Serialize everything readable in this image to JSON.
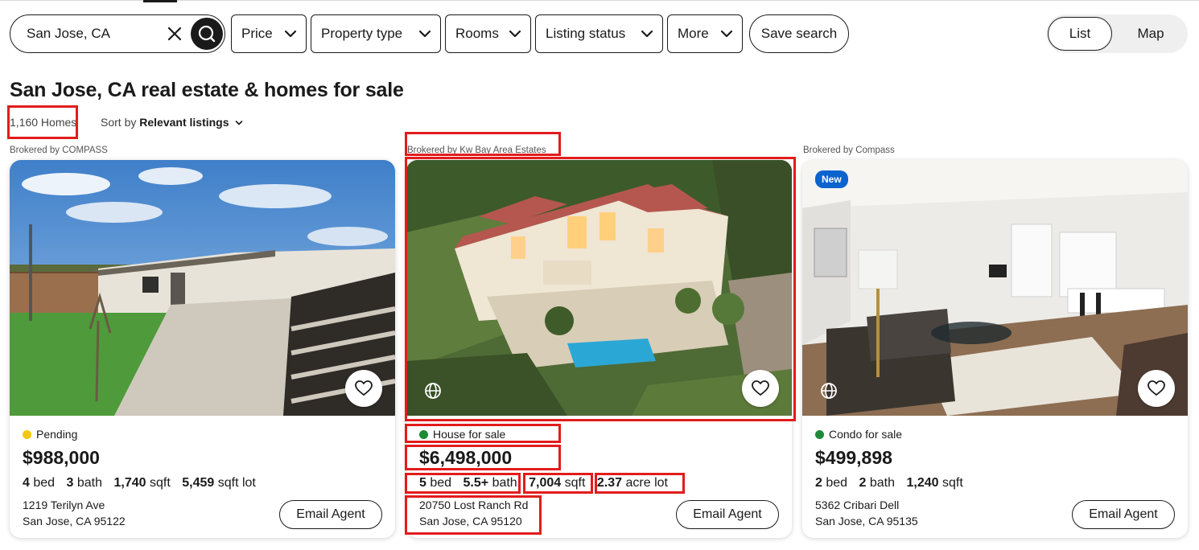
{
  "search": {
    "value": "San Jose, CA"
  },
  "filters": [
    {
      "label": "Price"
    },
    {
      "label": "Property type"
    },
    {
      "label": "Rooms"
    },
    {
      "label": "Listing status"
    },
    {
      "label": "More"
    }
  ],
  "save_search_label": "Save search",
  "view_toggle": {
    "list": "List",
    "map": "Map",
    "selected": "List"
  },
  "page_title": "San Jose, CA real estate & homes for sale",
  "home_count": "1,160 Homes",
  "sort": {
    "prefix": "Sort by",
    "value": "Relevant listings"
  },
  "listings": [
    {
      "broker": "Brokered by COMPASS",
      "status": "Pending",
      "status_color": "#f2c811",
      "price": "$988,000",
      "beds": "4",
      "beds_label": "bed",
      "baths": "3",
      "baths_label": "bath",
      "sqft": "1,740",
      "sqft_label": "sqft",
      "lot": "5,459",
      "lot_label": "sqft lot",
      "address_line1": "1219 Terilyn Ave",
      "address_line2": "San Jose, CA 95122",
      "email_label": "Email Agent"
    },
    {
      "broker": "Brokered by Kw Bay Area Estates",
      "status": "House for sale",
      "status_color": "#1d8a36",
      "price": "$6,498,000",
      "beds": "5",
      "beds_label": "bed",
      "baths": "5.5+",
      "baths_label": "bath",
      "sqft": "7,004",
      "sqft_label": "sqft",
      "lot": "2.37",
      "lot_label": "acre lot",
      "address_line1": "20750 Lost Ranch Rd",
      "address_line2": "San Jose, CA 95120",
      "email_label": "Email Agent"
    },
    {
      "broker": "Brokered by Compass",
      "badge": "New",
      "status": "Condo for sale",
      "status_color": "#1d8a36",
      "price": "$499,898",
      "beds": "2",
      "beds_label": "bed",
      "baths": "2",
      "baths_label": "bath",
      "sqft": "1,240",
      "sqft_label": "sqft",
      "address_line1": "5362 Cribari Dell",
      "address_line2": "San Jose, CA 95135",
      "email_label": "Email Agent"
    }
  ],
  "icons": [
    "clear-icon",
    "search-icon",
    "chevron-down-icon",
    "heart-icon",
    "globe-icon"
  ],
  "colors": {
    "highlight": "#e21c1c",
    "new_badge": "#0b63ce",
    "text": "#1a1a1a"
  }
}
